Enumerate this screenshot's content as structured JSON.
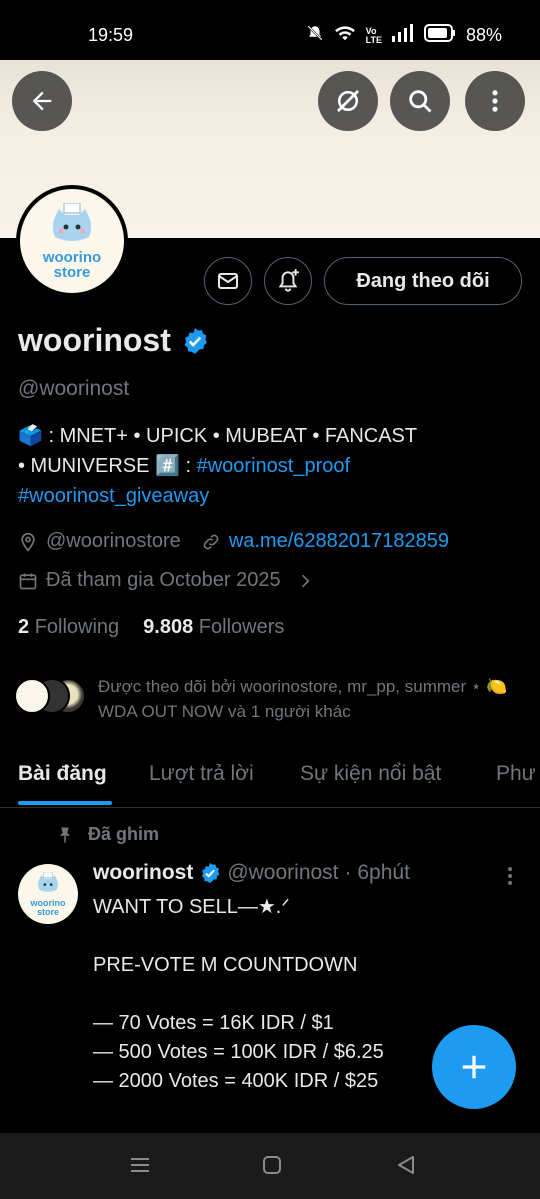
{
  "status": {
    "time": "19:59",
    "battery": "88%"
  },
  "profile": {
    "name": "woorinost",
    "handle": "@woorinost",
    "avatar_text_1": "woorino",
    "avatar_text_2": "store",
    "following_button": "Đang theo dõi"
  },
  "bio": {
    "line1_emoji": "🗳️",
    "line1": " : MNET+ • UPICK • MUBEAT • FANCAST",
    "line2_prefix": "• MUNIVERSE ",
    "line2_emoji": "#️⃣",
    "line2_sep": " : ",
    "hashtag1": "#woorinost_proof",
    "hashtag2": "#woorinost_giveaway"
  },
  "meta": {
    "location": "@woorinostore",
    "website": "wa.me/62882017182859",
    "joined": "Đã tham gia October 2025"
  },
  "counts": {
    "following_num": "2",
    "following_label": "Following",
    "followers_num": "9.808",
    "followers_label": "Followers"
  },
  "followed_by": "Được theo dõi bởi woorinostore, mr_pp, summer ⋆ 🍋 WDA OUT NOW và 1 người khác",
  "tabs": [
    "Bài đăng",
    "Lượt trả lời",
    "Sự kiện nổi bật",
    "Phư"
  ],
  "tweet": {
    "pinned_label": "Đã ghim",
    "name": "woorinost",
    "handle": "@woorinost",
    "time": "· 6phút",
    "body": "WANT TO SELL—★.ᐟ\n\nPRE-VOTE M COUNTDOWN\n\n— 70 Votes = 16K IDR / $1\n— 500 Votes = 100K IDR / $6.25\n— 2000 Votes = 400K IDR / $25"
  },
  "colors": {
    "accent": "#1d9bf0",
    "muted": "#71767b",
    "text": "#e7e9ea",
    "background": "#000000"
  }
}
